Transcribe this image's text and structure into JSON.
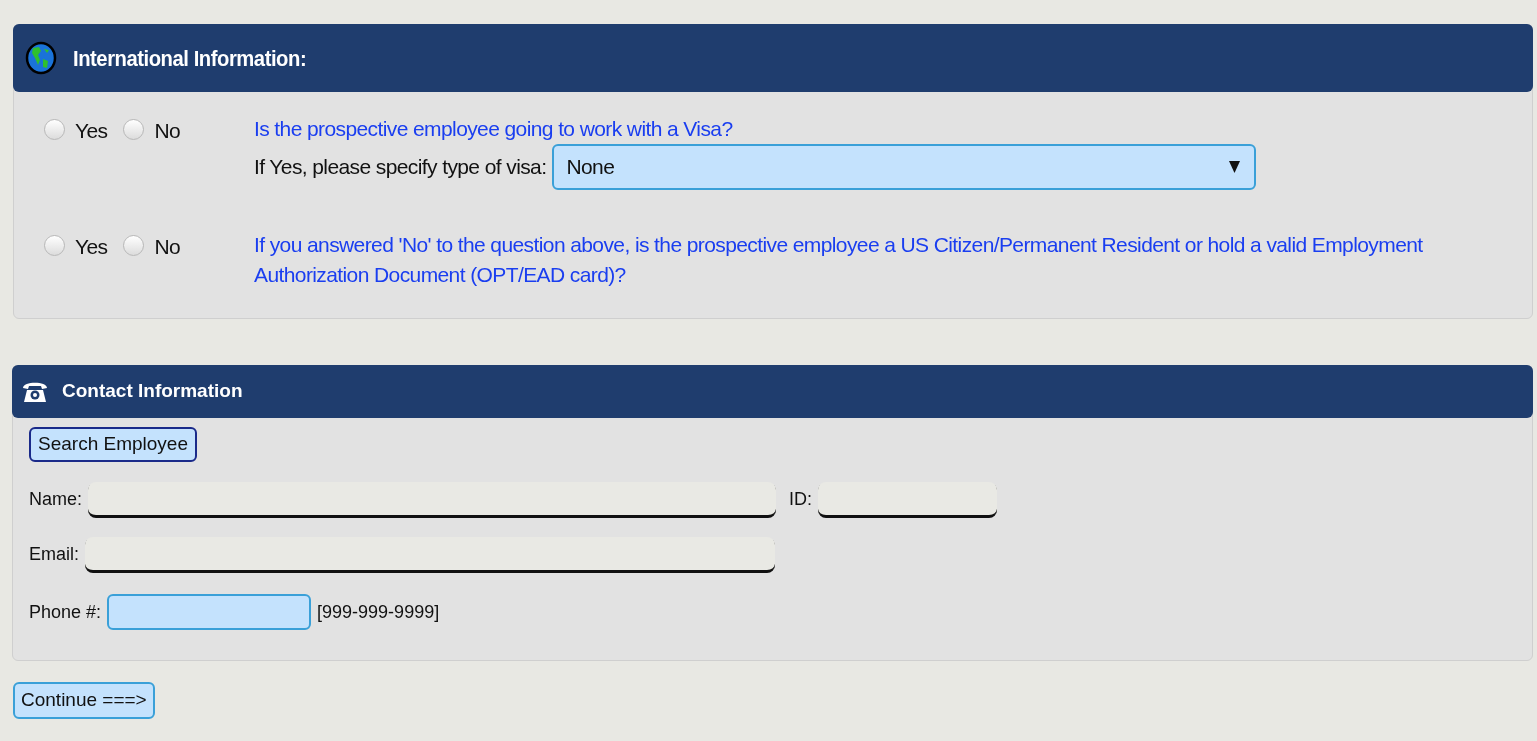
{
  "international": {
    "title": "International Information:",
    "questions": [
      {
        "options": [
          {
            "label": "Yes",
            "selected": false
          },
          {
            "label": "No",
            "selected": false
          }
        ],
        "text": "Is the prospective employee going to work with a Visa?",
        "visa_label": "If Yes, please specify type of visa:",
        "visa_value": "None"
      },
      {
        "options": [
          {
            "label": "Yes",
            "selected": false
          },
          {
            "label": "No",
            "selected": false
          }
        ],
        "text": "If you answered 'No' to the question above, is the prospective employee a US Citizen/Permanent Resident or hold a valid Employment Authorization Document (OPT/EAD card)?"
      }
    ]
  },
  "contact": {
    "title": "Contact Information",
    "search_button": "Search Employee",
    "name_label": "Name:",
    "id_label": "ID:",
    "email_label": "Email:",
    "phone_label": "Phone #:",
    "phone_hint": "[999-999-9999]"
  },
  "continue_button": "Continue ===>"
}
